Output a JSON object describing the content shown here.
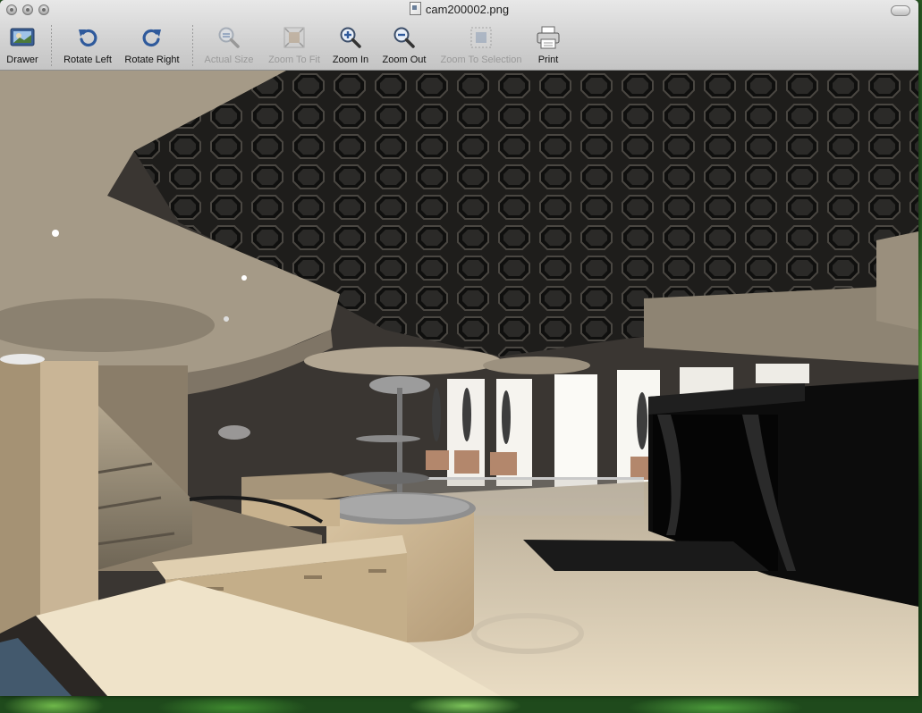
{
  "window": {
    "title": "cam200002.png"
  },
  "toolbar": {
    "items": [
      {
        "label": "Drawer",
        "icon": "drawer-icon",
        "enabled": true
      },
      {
        "label": "Rotate Left",
        "icon": "rotate-left-icon",
        "enabled": true
      },
      {
        "label": "Rotate Right",
        "icon": "rotate-right-icon",
        "enabled": true
      },
      {
        "label": "Actual Size",
        "icon": "actual-size-icon",
        "enabled": false
      },
      {
        "label": "Zoom To Fit",
        "icon": "zoom-to-fit-icon",
        "enabled": false
      },
      {
        "label": "Zoom In",
        "icon": "zoom-in-icon",
        "enabled": true
      },
      {
        "label": "Zoom Out",
        "icon": "zoom-out-icon",
        "enabled": true
      },
      {
        "label": "Zoom To Selection",
        "icon": "zoom-to-selection-icon",
        "enabled": false
      },
      {
        "label": "Print",
        "icon": "printer-icon",
        "enabled": true
      }
    ]
  },
  "colors": {
    "toolbar_top": "#e8e8e8",
    "toolbar_bottom": "#c4c4c4",
    "icon_blue": "#2f5a9c",
    "disabled_text": "#9a9a9a"
  }
}
